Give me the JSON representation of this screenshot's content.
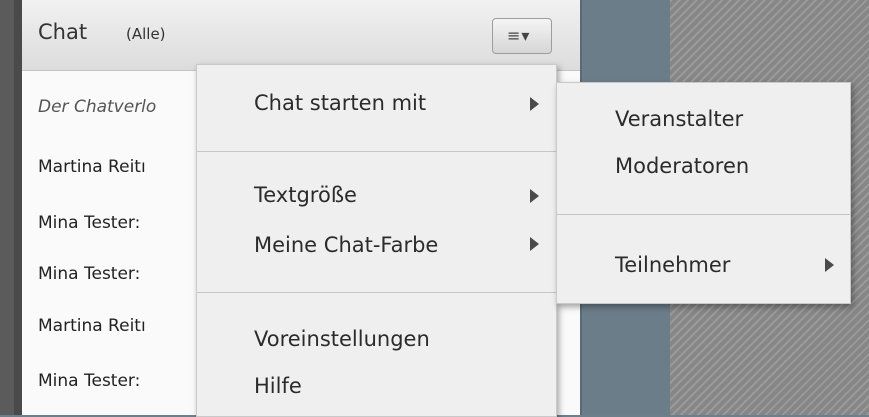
{
  "pod": {
    "title": "Chat",
    "scope": "(Alle)",
    "menu_button_glyph": "≡▾",
    "messages": [
      "Der Chatverlo",
      "Martina Reitı",
      "Mina Tester:",
      "Mina Tester:",
      "Martina Reitı",
      "Mina Tester:"
    ]
  },
  "menu": {
    "items": [
      {
        "label": "Chat starten mit",
        "has_submenu": true
      },
      {
        "label": "Textgröße",
        "has_submenu": true
      },
      {
        "label": "Meine Chat-Farbe",
        "has_submenu": true
      },
      {
        "label": "Voreinstellungen",
        "has_submenu": false
      },
      {
        "label": "Hilfe",
        "has_submenu": false
      }
    ]
  },
  "submenu": {
    "items": [
      {
        "label": "Veranstalter",
        "has_submenu": false
      },
      {
        "label": "Moderatoren",
        "has_submenu": false
      },
      {
        "label": "Teilnehmer",
        "has_submenu": true
      }
    ]
  },
  "colors": {
    "menu_bg": "#efefef",
    "header_bg": "#dcdcdc",
    "side_panel": "#6c7d8a"
  }
}
